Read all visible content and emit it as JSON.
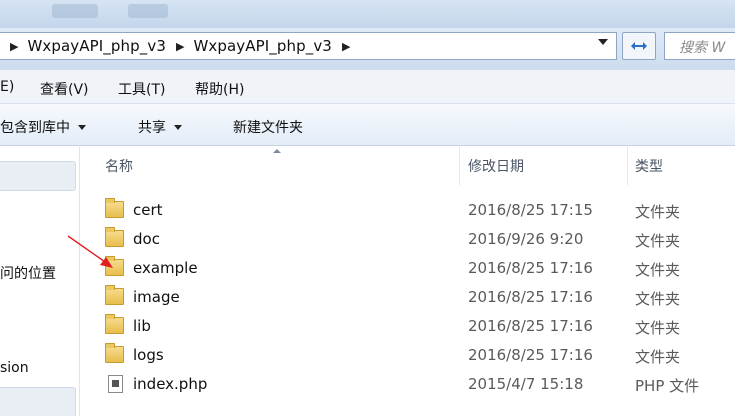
{
  "address_bar": {
    "crumbs": [
      "WxpayAPI_php_v3",
      "WxpayAPI_php_v3"
    ],
    "search_placeholder": "搜索 W"
  },
  "menu": {
    "items": [
      "E)",
      "查看(V)",
      "工具(T)",
      "帮助(H)"
    ]
  },
  "toolbar": {
    "include_label": "包含到库中",
    "share_label": "共享",
    "new_folder_label": "新建文件夹"
  },
  "nav_pane": {
    "items": [
      "问的位置",
      "sion"
    ]
  },
  "columns": {
    "name": "名称",
    "modified": "修改日期",
    "type": "类型"
  },
  "files": [
    {
      "name": "cert",
      "date": "2016/8/25 17:15",
      "type": "文件夹",
      "icon": "folder-icon"
    },
    {
      "name": "doc",
      "date": "2016/9/26 9:20",
      "type": "文件夹",
      "icon": "folder-icon"
    },
    {
      "name": "example",
      "date": "2016/8/25 17:16",
      "type": "文件夹",
      "icon": "folder-icon"
    },
    {
      "name": "image",
      "date": "2016/8/25 17:16",
      "type": "文件夹",
      "icon": "folder-icon"
    },
    {
      "name": "lib",
      "date": "2016/8/25 17:16",
      "type": "文件夹",
      "icon": "folder-icon"
    },
    {
      "name": "logs",
      "date": "2016/8/25 17:16",
      "type": "文件夹",
      "icon": "folder-icon"
    },
    {
      "name": "index.php",
      "date": "2015/4/7 15:18",
      "type": "PHP 文件",
      "icon": "php-file-icon"
    }
  ],
  "colors": {
    "annotation_arrow": "#e02020"
  }
}
